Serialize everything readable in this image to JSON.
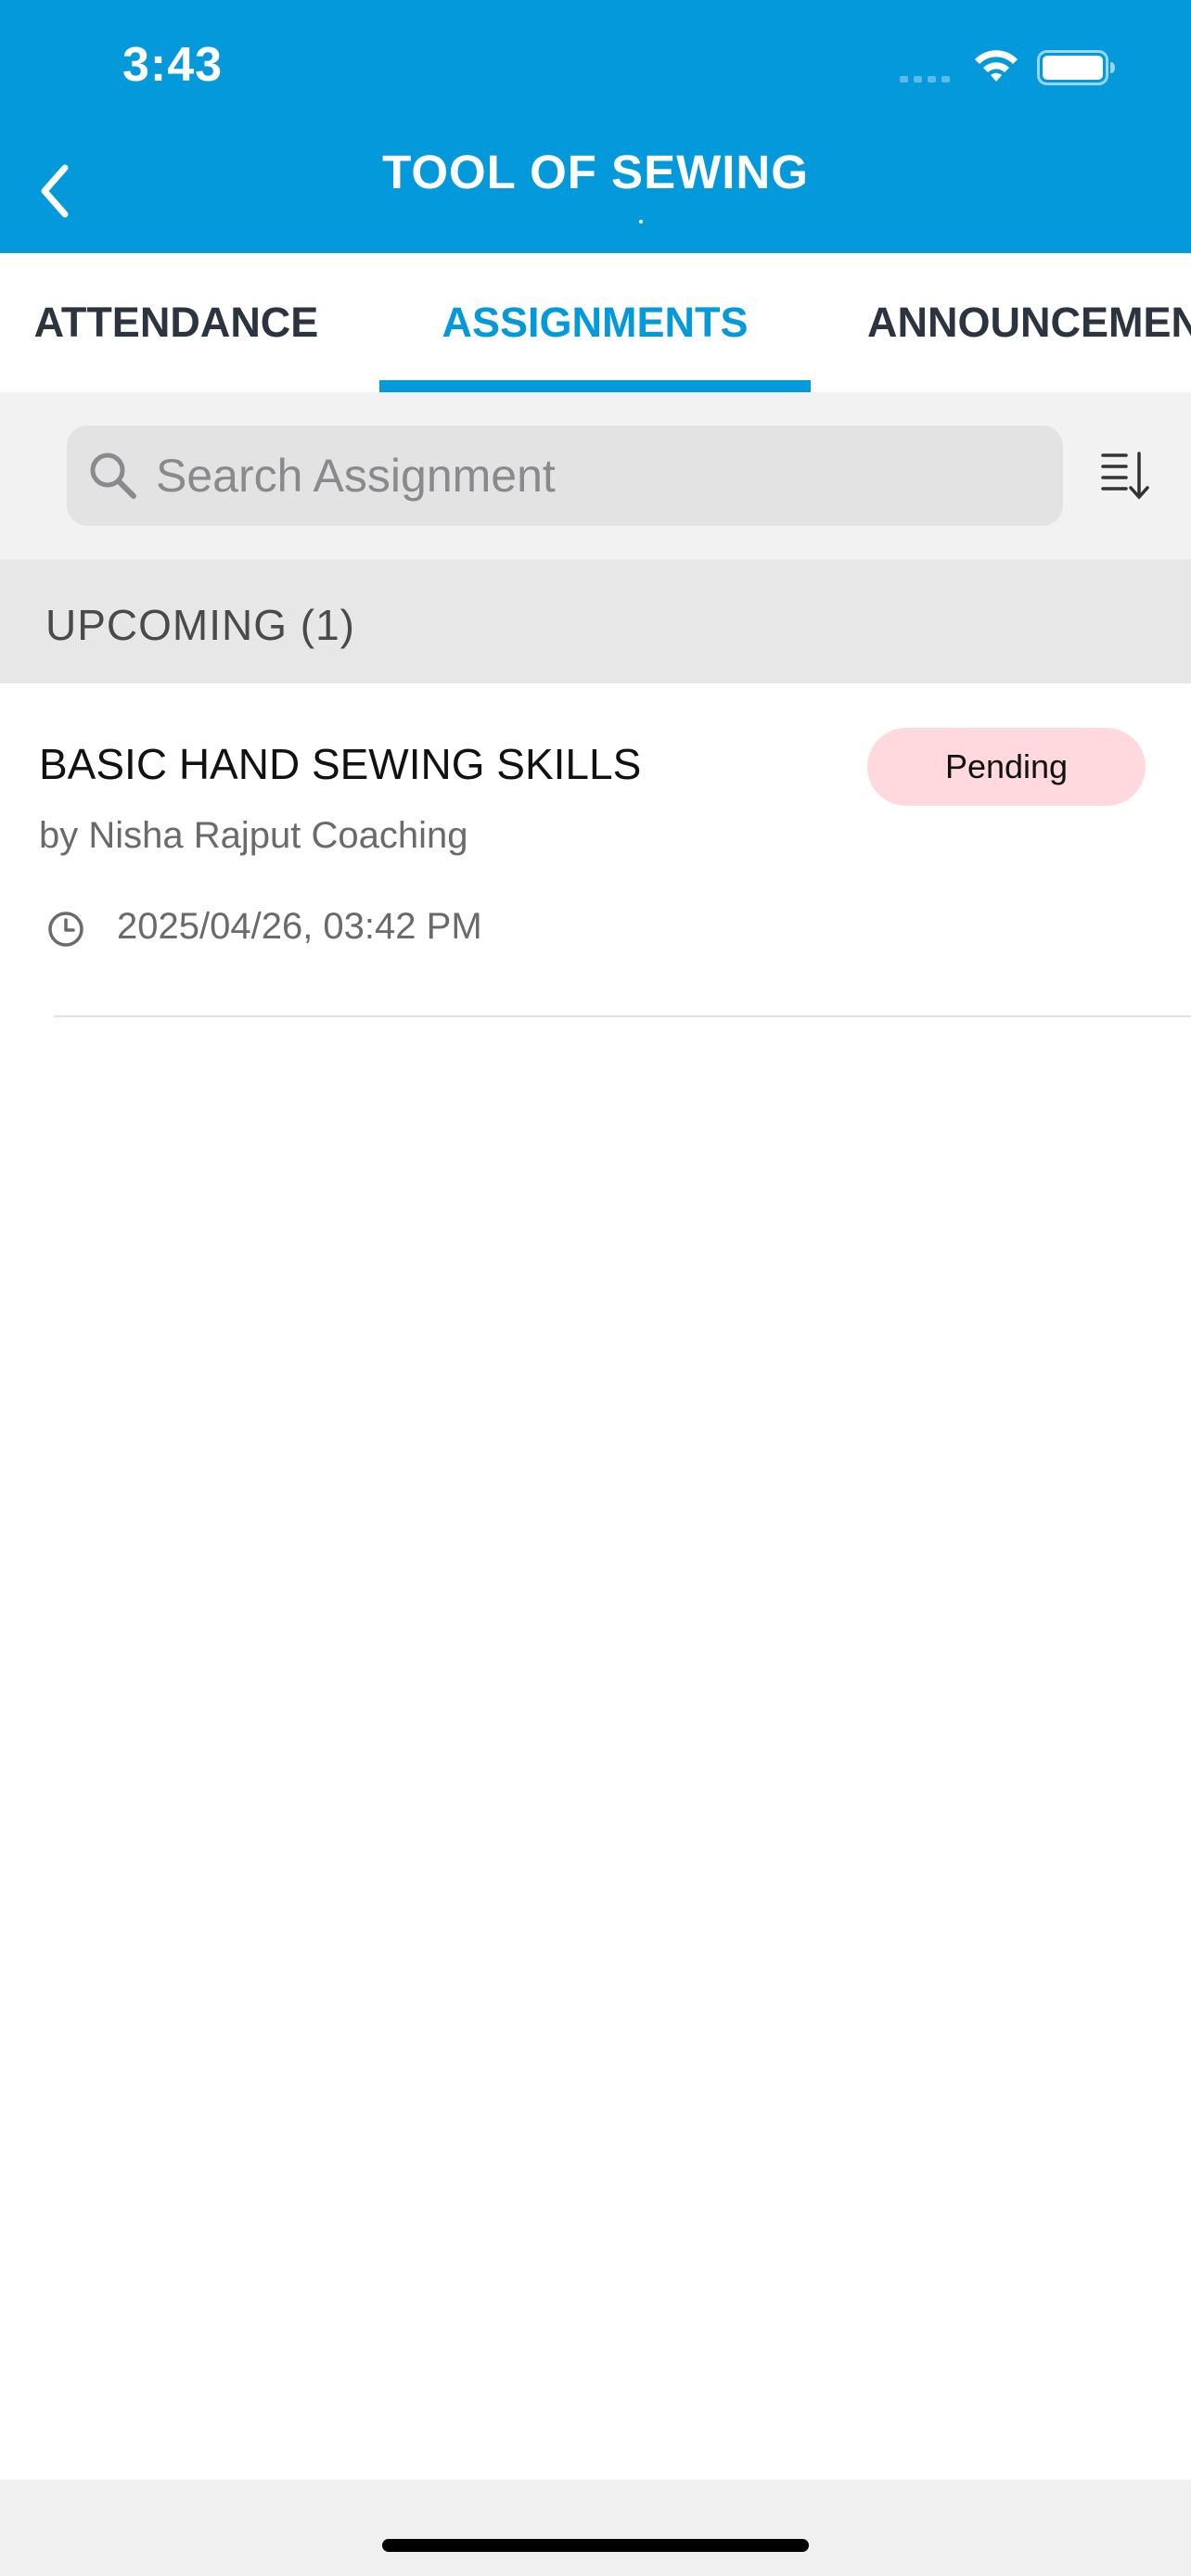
{
  "status_bar": {
    "time": "3:43"
  },
  "nav": {
    "title": "TOOL OF SEWING",
    "back_icon": "chevron-left-icon"
  },
  "tabs": [
    {
      "label": "ATTENDANCE",
      "active": false
    },
    {
      "label": "ASSIGNMENTS",
      "active": true
    },
    {
      "label": "ANNOUNCEMENTS",
      "active": false
    }
  ],
  "search": {
    "placeholder": "Search Assignment",
    "value": ""
  },
  "sort_icon": "sort-descending-icon",
  "section": {
    "title": "UPCOMING (1)"
  },
  "assignments": [
    {
      "title": "BASIC HAND SEWING SKILLS",
      "author": "by Nisha Rajput Coaching",
      "datetime": "2025/04/26, 03:42 PM",
      "status": "Pending"
    }
  ],
  "colors": {
    "primary": "#0499db",
    "header_text": "#ffffff",
    "tab_inactive": "#2c3440",
    "pending_badge_bg": "#ffd9de"
  }
}
